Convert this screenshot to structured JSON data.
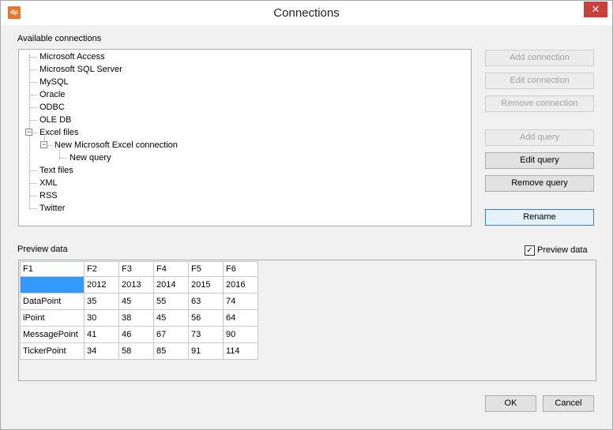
{
  "window": {
    "title": "Connections",
    "app_icon_text": "dp",
    "close_glyph": "✕"
  },
  "available": {
    "label": "Available connections",
    "tree": [
      "Microsoft Access",
      "Microsoft SQL Server",
      "MySQL",
      "Oracle",
      "ODBC",
      "OLE DB",
      "Excel files",
      "New Microsoft Excel connection",
      "New query",
      "Text files",
      "XML",
      "RSS",
      "Twitter"
    ],
    "expander_glyph": "−"
  },
  "buttons": {
    "add_connection": "Add connection",
    "edit_connection": "Edit connection",
    "remove_connection": "Remove connection",
    "add_query": "Add query",
    "edit_query": "Edit query",
    "remove_query": "Remove query",
    "rename": "Rename",
    "ok": "OK",
    "cancel": "Cancel"
  },
  "preview": {
    "label": "Preview data",
    "checkbox_label": "Preview data",
    "checked": true,
    "check_glyph": "✓",
    "columns": [
      "F1",
      "F2",
      "F3",
      "F4",
      "F5",
      "F6"
    ],
    "rows": [
      [
        "",
        "2012",
        "2013",
        "2014",
        "2015",
        "2016"
      ],
      [
        "DataPoint",
        "35",
        "45",
        "55",
        "63",
        "74"
      ],
      [
        "iPoint",
        "30",
        "38",
        "45",
        "56",
        "64"
      ],
      [
        "MessagePoint",
        "41",
        "46",
        "67",
        "73",
        "90"
      ],
      [
        "TickerPoint",
        "34",
        "58",
        "85",
        "91",
        "114"
      ]
    ]
  },
  "colors": {
    "selection": "#3399ff",
    "close": "#c7403c",
    "accent": "#e5772a"
  }
}
